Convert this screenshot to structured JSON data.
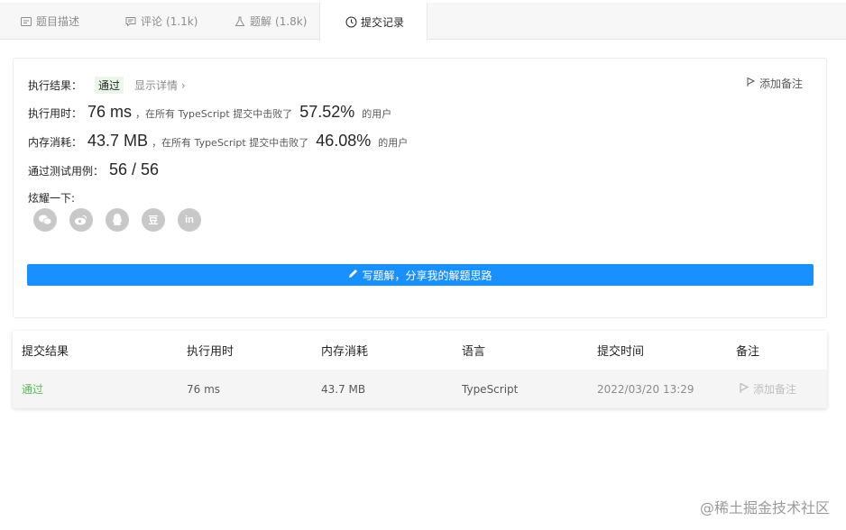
{
  "tabs": [
    {
      "label": "题目描述",
      "count": ""
    },
    {
      "label": "评论",
      "count": "(1.1k)"
    },
    {
      "label": "题解",
      "count": "(1.8k)"
    },
    {
      "label": "提交记录",
      "count": ""
    }
  ],
  "result": {
    "label": "执行结果：",
    "status": "通过",
    "details_link": "显示详情 ›",
    "add_note": "添加备注"
  },
  "runtime": {
    "label": "执行用时：",
    "value": "76 ms",
    "text1": "，在所有 TypeScript 提交中击败了",
    "percent": "57.52%",
    "text2": "的用户"
  },
  "memory": {
    "label": "内存消耗：",
    "value": "43.7 MB",
    "text1": "，在所有 TypeScript 提交中击败了",
    "percent": "46.08%",
    "text2": "的用户"
  },
  "tests": {
    "label": "通过测试用例：",
    "value": "56 / 56"
  },
  "share": {
    "label": "炫耀一下:",
    "icons": [
      "wechat-icon",
      "weibo-icon",
      "qq-icon",
      "douban-icon",
      "linkedin-icon"
    ],
    "douban_glyph": "豆",
    "linkedin_glyph": "in"
  },
  "write_button": "写题解，分享我的解题思路",
  "table": {
    "headers": [
      "提交结果",
      "执行用时",
      "内存消耗",
      "语言",
      "提交时间",
      "备注"
    ],
    "row": {
      "status": "通过",
      "runtime": "76 ms",
      "memory": "43.7 MB",
      "language": "TypeScript",
      "time": "2022/03/20 13:29",
      "note": "添加备注"
    }
  },
  "watermark": "@稀土掘金技术社区",
  "colors": {
    "accent": "#1890ff",
    "success": "#5cb85c",
    "badge_bg": "#eaf7ea"
  }
}
